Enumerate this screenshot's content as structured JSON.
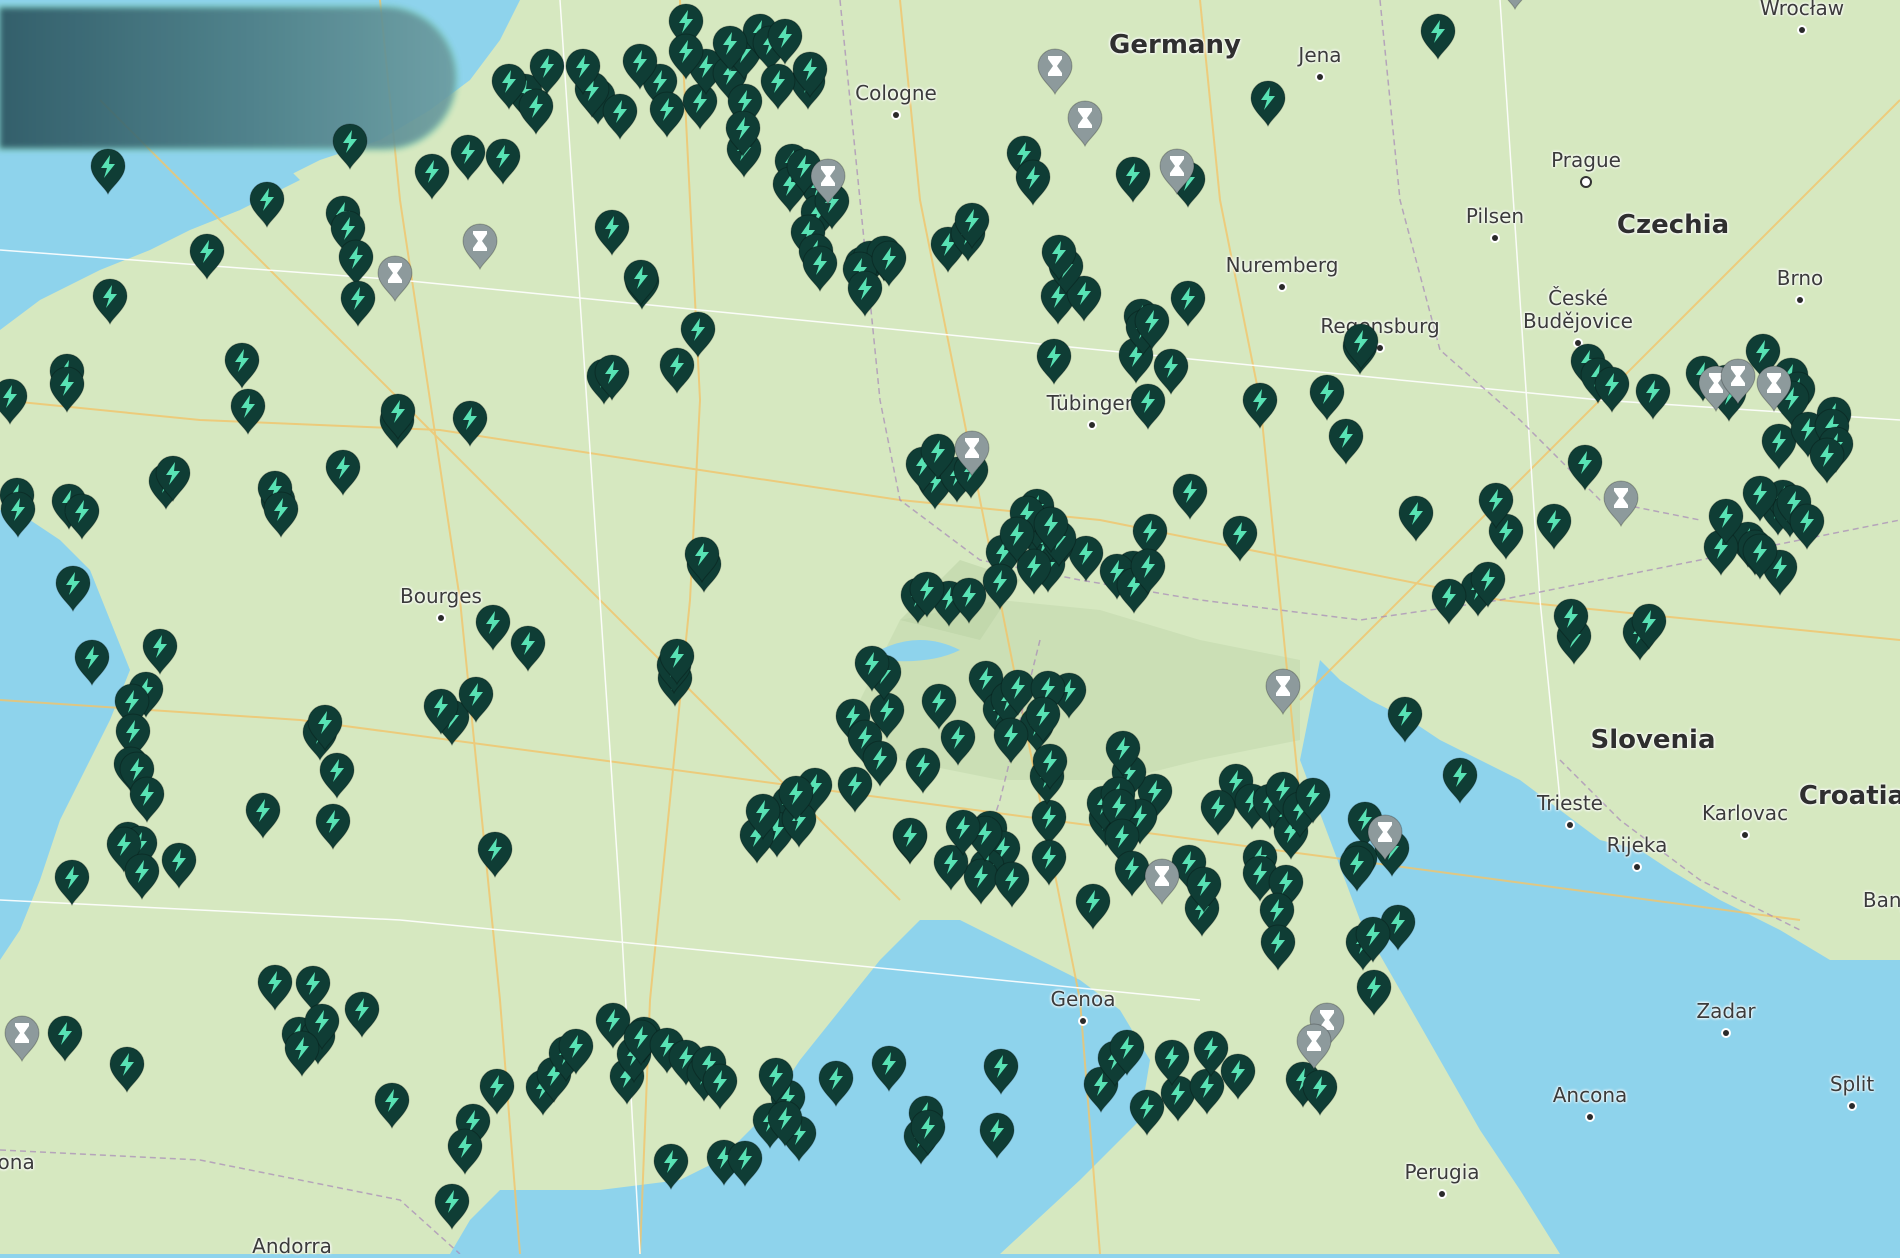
{
  "map": {
    "countries": [
      {
        "name": "Germany"
      },
      {
        "name": "Czechia"
      },
      {
        "name": "Slovenia"
      },
      {
        "name": "Croatia"
      }
    ],
    "cities": [
      {
        "name": "Cologne"
      },
      {
        "name": "Jena"
      },
      {
        "name": "Wrocław"
      },
      {
        "name": "Prague",
        "capital": true
      },
      {
        "name": "Pilsen"
      },
      {
        "name": "Nuremberg"
      },
      {
        "name": "Brno"
      },
      {
        "name": "České"
      },
      {
        "name": "Budějovice"
      },
      {
        "name": "Regensburg"
      },
      {
        "name": "Tübingen"
      },
      {
        "name": "Bourges"
      },
      {
        "name": "Trieste"
      },
      {
        "name": "Karlovac"
      },
      {
        "name": "Rijeka"
      },
      {
        "name": "Banj"
      },
      {
        "name": "Genoa"
      },
      {
        "name": "Zadar"
      },
      {
        "name": "Ancona"
      },
      {
        "name": "Split"
      },
      {
        "name": "Perugia"
      },
      {
        "name": "plona"
      },
      {
        "name": "Andorra"
      }
    ],
    "colors": {
      "land": "#d6e8c0",
      "sea": "#8ed3ec",
      "active_pin": "#0f3d35",
      "active_bolt": "#58e2b4",
      "pending_pin": "#8d9a9c",
      "pending_icon": "#ffffff"
    },
    "pin_types": {
      "active": "lightning-bolt-icon",
      "pending": "hourglass-icon"
    }
  }
}
